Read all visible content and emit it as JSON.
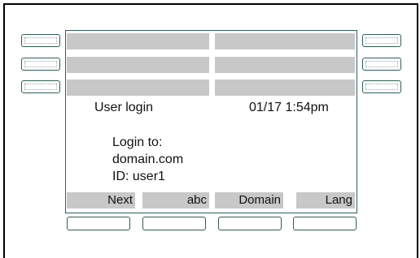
{
  "screen": {
    "title": "User login",
    "datetime": "01/17 1:54pm",
    "body": {
      "line1": "Login to:",
      "line2": "domain.com",
      "line3": "ID: user1"
    }
  },
  "softkeys": [
    {
      "label": "Next"
    },
    {
      "label": "abc"
    },
    {
      "label": "Domain"
    },
    {
      "label": "Lang"
    }
  ],
  "colors": {
    "screen_border": "#2f5f57",
    "bar_fill": "#c8c8c8"
  }
}
